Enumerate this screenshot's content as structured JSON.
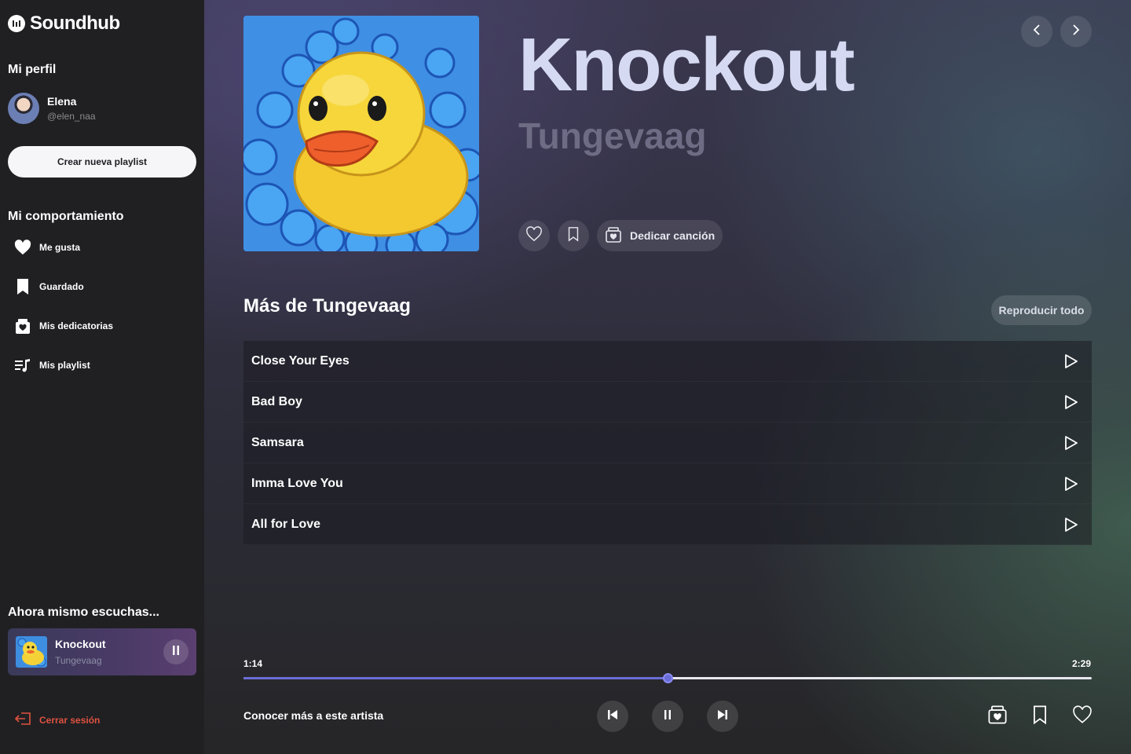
{
  "app": {
    "name": "Soundhub"
  },
  "sidebar": {
    "profile_heading": "Mi perfil",
    "profile": {
      "name": "Elena",
      "handle": "@elen_naa"
    },
    "create_playlist_label": "Crear nueva playlist",
    "behavior_heading": "Mi comportamiento",
    "items": [
      {
        "label": "Me gusta",
        "icon": "heart-icon"
      },
      {
        "label": "Guardado",
        "icon": "bookmark-icon"
      },
      {
        "label": "Mis dedicatorias",
        "icon": "gift-box-icon"
      },
      {
        "label": "Mis playlist",
        "icon": "playlist-icon"
      }
    ],
    "now_listening_heading": "Ahora mismo escuchas...",
    "now_playing": {
      "title": "Knockout",
      "artist": "Tungevaag"
    },
    "logout_label": "Cerrar sesión"
  },
  "song": {
    "title": "Knockout",
    "artist": "Tungevaag",
    "dedicate_label": "Dedicar canción"
  },
  "more": {
    "heading": "Más de Tungevaag",
    "play_all_label": "Reproducir todo",
    "tracks": [
      {
        "title": "Close Your Eyes"
      },
      {
        "title": "Bad Boy"
      },
      {
        "title": "Samsara"
      },
      {
        "title": "Imma Love You"
      },
      {
        "title": "All for Love"
      }
    ]
  },
  "player": {
    "current_time": "1:14",
    "total_time": "2:29",
    "progress": 0.5,
    "artist_link_label": "Conocer más a este artista"
  },
  "colors": {
    "accent": "#6b6dd8",
    "logout": "#e0523f",
    "sidebar_bg": "#202023"
  }
}
